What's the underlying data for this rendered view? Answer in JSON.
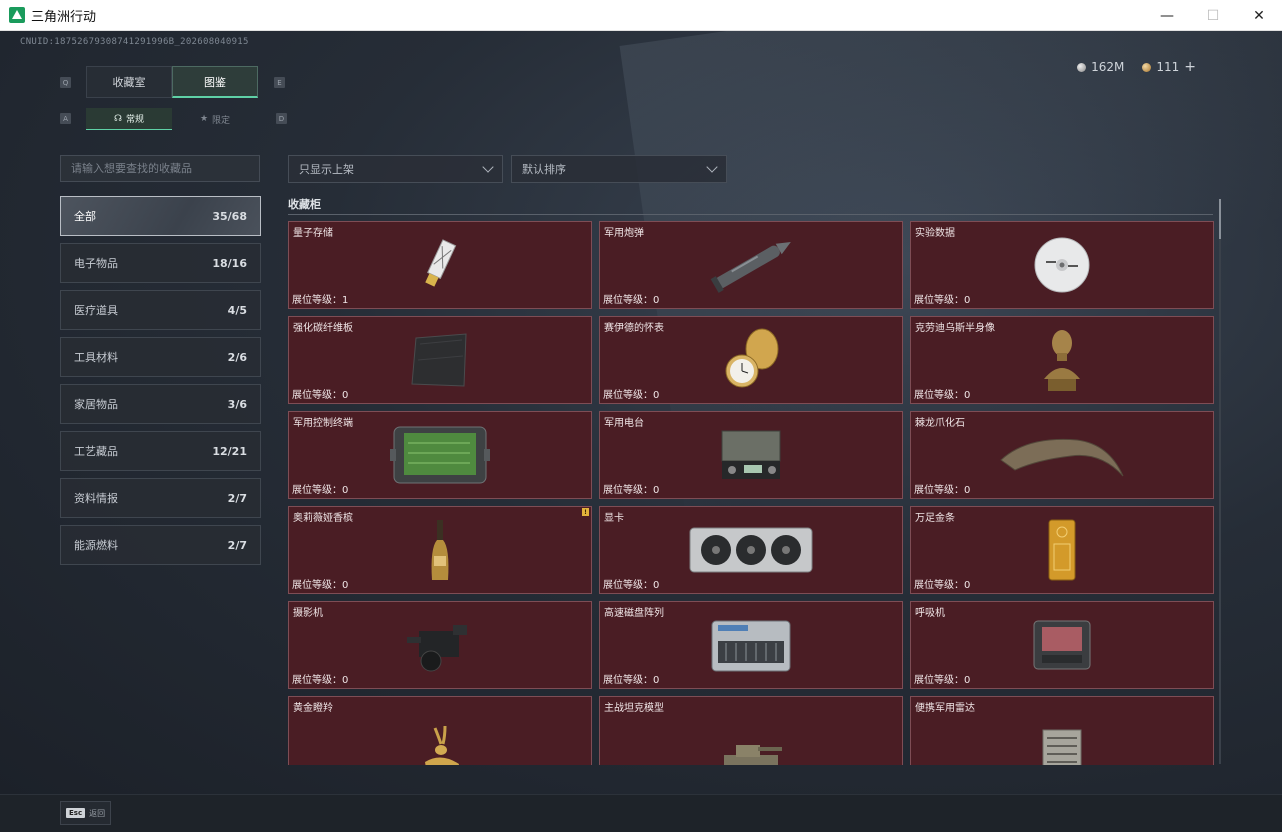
{
  "window": {
    "title": "三角洲行动"
  },
  "uid": "CNUID:18752679308741291996B_202608040915",
  "currency": {
    "silver": "162M",
    "gold": "111",
    "plus": "+"
  },
  "keyhints": {
    "q": "Q",
    "e": "E",
    "a": "A",
    "d": "D"
  },
  "top_tabs": [
    "收藏室",
    "图鉴"
  ],
  "sub_tabs": [
    "常规",
    "限定"
  ],
  "search": {
    "placeholder": "请输入想要查找的收藏品"
  },
  "filters": {
    "display": "只显示上架",
    "sort": "默认排序"
  },
  "categories": [
    {
      "label": "全部",
      "count": "35/68"
    },
    {
      "label": "电子物品",
      "count": "18/16"
    },
    {
      "label": "医疗道具",
      "count": "4/5"
    },
    {
      "label": "工具材料",
      "count": "2/6"
    },
    {
      "label": "家居物品",
      "count": "3/6"
    },
    {
      "label": "工艺藏品",
      "count": "12/21"
    },
    {
      "label": "资料情报",
      "count": "2/7"
    },
    {
      "label": "能源燃料",
      "count": "2/7"
    }
  ],
  "cabinet": {
    "title": "收藏柜",
    "level_label": "展位等级：",
    "items": [
      {
        "name": "量子存储",
        "level": "1",
        "icon": "usb-drive-icon"
      },
      {
        "name": "军用炮弹",
        "level": "0",
        "icon": "artillery-shell-icon"
      },
      {
        "name": "实验数据",
        "level": "0",
        "icon": "data-disc-icon"
      },
      {
        "name": "强化碳纤维板",
        "level": "0",
        "icon": "carbon-plate-icon"
      },
      {
        "name": "赛伊德的怀表",
        "level": "0",
        "icon": "pocket-watch-icon"
      },
      {
        "name": "克劳迪乌斯半身像",
        "level": "0",
        "icon": "bust-statue-icon"
      },
      {
        "name": "军用控制终端",
        "level": "0",
        "icon": "control-terminal-icon"
      },
      {
        "name": "军用电台",
        "level": "0",
        "icon": "military-radio-icon"
      },
      {
        "name": "棘龙爪化石",
        "level": "0",
        "icon": "claw-fossil-icon"
      },
      {
        "name": "奥莉薇娅香槟",
        "level": "0",
        "icon": "champagne-bottle-icon",
        "warn": "!"
      },
      {
        "name": "显卡",
        "level": "0",
        "icon": "graphics-card-icon"
      },
      {
        "name": "万足金条",
        "level": "0",
        "icon": "gold-bar-icon"
      },
      {
        "name": "摄影机",
        "level": "0",
        "icon": "video-camera-icon"
      },
      {
        "name": "高速磁盘阵列",
        "level": "0",
        "icon": "disk-array-icon"
      },
      {
        "name": "呼吸机",
        "level": "0",
        "icon": "ventilator-icon"
      },
      {
        "name": "黄金瞪羚",
        "level": "",
        "icon": "golden-gazelle-icon"
      },
      {
        "name": "主战坦克模型",
        "level": "",
        "icon": "tank-model-icon"
      },
      {
        "name": "便携军用雷达",
        "level": "",
        "icon": "portable-radar-icon"
      }
    ]
  },
  "bottom": {
    "esc_key": "Esc",
    "esc_label": "返回"
  }
}
